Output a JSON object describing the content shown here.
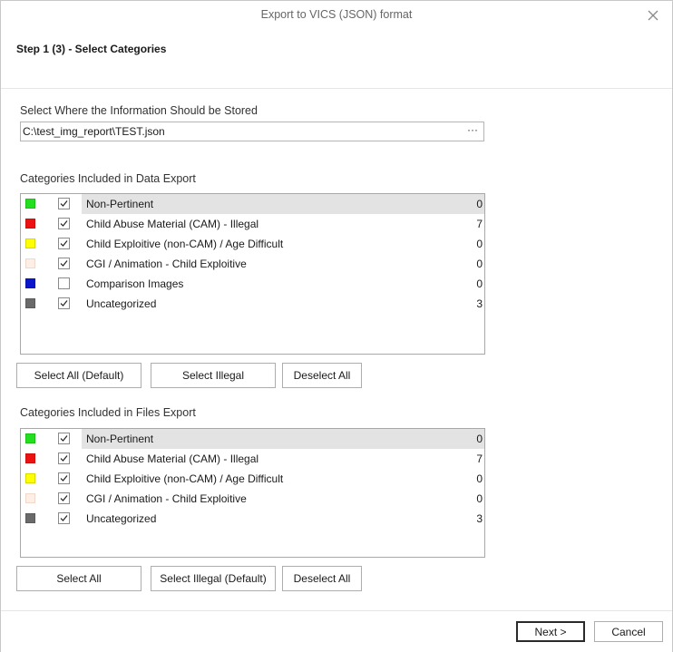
{
  "window": {
    "title": "Export to VICS (JSON) format",
    "step_title": "Step 1 (3) - Select Categories"
  },
  "storage": {
    "label": "Select Where the Information Should be Stored",
    "path_value": "C:\\test_img_report\\TEST.json",
    "browse_label": "···"
  },
  "data_export": {
    "label": "Categories Included in Data Export",
    "rows": [
      {
        "color": "#22e01e",
        "checked": true,
        "label": "Non-Pertinent",
        "count": "0"
      },
      {
        "color": "#ee1111",
        "checked": true,
        "label": "Child Abuse Material (CAM) - Illegal",
        "count": "7"
      },
      {
        "color": "#ffff00",
        "checked": true,
        "label": "Child Exploitive (non-CAM) / Age Difficult",
        "count": "0"
      },
      {
        "color": "#fdeee6",
        "checked": true,
        "label": "CGI / Animation - Child Exploitive",
        "count": "0"
      },
      {
        "color": "#0b15cc",
        "checked": false,
        "label": "Comparison Images",
        "count": "0"
      },
      {
        "color": "#6a6a6a",
        "checked": true,
        "label": "Uncategorized",
        "count": "3"
      }
    ],
    "buttons": {
      "select_all": "Select All (Default)",
      "select_illegal": "Select Illegal",
      "deselect_all": "Deselect All"
    }
  },
  "files_export": {
    "label": "Categories Included in Files Export",
    "rows": [
      {
        "color": "#22e01e",
        "checked": true,
        "label": "Non-Pertinent",
        "count": "0"
      },
      {
        "color": "#ee1111",
        "checked": true,
        "label": "Child Abuse Material (CAM) - Illegal",
        "count": "7"
      },
      {
        "color": "#ffff00",
        "checked": true,
        "label": "Child Exploitive (non-CAM) / Age Difficult",
        "count": "0"
      },
      {
        "color": "#fdeee6",
        "checked": true,
        "label": "CGI / Animation - Child Exploitive",
        "count": "0"
      },
      {
        "color": "#6a6a6a",
        "checked": true,
        "label": "Uncategorized",
        "count": "3"
      }
    ],
    "buttons": {
      "select_all": "Select All",
      "select_illegal": "Select Illegal (Default)",
      "deselect_all": "Deselect All"
    }
  },
  "footer": {
    "next_label": "Next >",
    "cancel_label": "Cancel"
  }
}
